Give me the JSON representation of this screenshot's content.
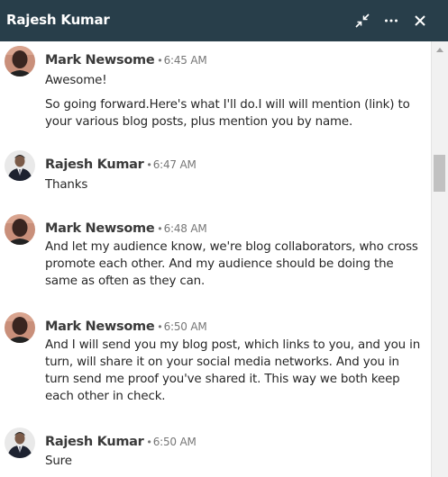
{
  "header": {
    "title": "Rajesh Kumar",
    "icons": [
      "collapse-icon",
      "more-icon",
      "close-icon"
    ],
    "background": "#283e4a"
  },
  "messages": [
    {
      "sender": "Mark Newsome",
      "time": "6:45 AM",
      "avatar": "mark-avatar",
      "lines": [
        "Awesome!",
        "So going forward.Here's what I'll do.I will will mention (link) to your various blog posts, plus mention you by name."
      ]
    },
    {
      "sender": "Rajesh Kumar",
      "time": "6:47 AM",
      "avatar": "rajesh-avatar",
      "lines": [
        "Thanks"
      ]
    },
    {
      "sender": "Mark Newsome",
      "time": "6:48 AM",
      "avatar": "mark-avatar",
      "lines": [
        "And let my audience know, we're blog collaborators, who cross promote each other. And my audience should be doing the same as often as they can."
      ]
    },
    {
      "sender": "Mark Newsome",
      "time": "6:50 AM",
      "avatar": "mark-avatar",
      "lines": [
        "And I will send you my blog post, which links to you, and you in turn, will share it on your social media networks. And you in turn send me proof you've shared it. This way we both keep each other in check."
      ]
    },
    {
      "sender": "Rajesh Kumar",
      "time": "6:50 AM",
      "avatar": "rajesh-avatar",
      "lines": [
        "Sure"
      ]
    }
  ],
  "separator": "•"
}
